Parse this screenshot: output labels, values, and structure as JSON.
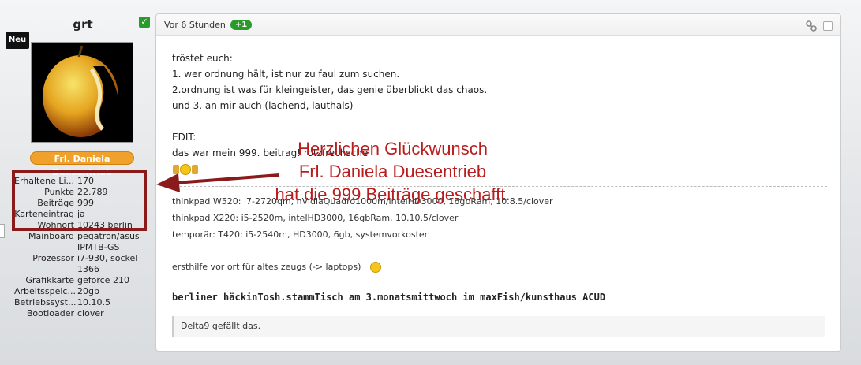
{
  "user": {
    "badge_new": "Neu",
    "name": "grt",
    "rank": "Frl. Daniela Duesentrieb",
    "info": [
      {
        "k": "Erhaltene Li...",
        "v": "170"
      },
      {
        "k": "Punkte",
        "v": "22.789"
      },
      {
        "k": "Beiträge",
        "v": "999"
      },
      {
        "k": "Karteneintrag",
        "v": "ja"
      },
      {
        "k": "Wohnort",
        "v": "10243 berlin"
      },
      {
        "k": "Mainboard",
        "v": "pegatron/asus IPMTB-GS"
      },
      {
        "k": "Prozessor",
        "v": "i7-930, sockel 1366"
      },
      {
        "k": "Grafikkarte",
        "v": "geforce 210"
      },
      {
        "k": "Arbeitsspeic...",
        "v": "20gb"
      },
      {
        "k": "Betriebssyst...",
        "v": "10.10.5"
      },
      {
        "k": "Bootloader",
        "v": "clover"
      }
    ]
  },
  "post": {
    "time": "Vor 6 Stunden",
    "plus": "+1",
    "lines": [
      "tröstet euch:",
      "1. wer ordnung hält, ist nur zu faul zum suchen.",
      "2.ordnung ist was für kleingeister, das genie überblickt das chaos.",
      "und 3. an mir auch (lachend, lauthals)"
    ],
    "edit_label": "EDIT:",
    "edit_text": "das war mein 999. beitrag! rotzfrechsche",
    "signature": [
      "thinkpad W520: i7-2720qm, nVidiaQuadro1000m/intelHD3000, 16gbRam, 10.8.5/clover",
      "thinkpad X220: i5-2520m, intelHD3000, 16gbRam, 10.10.5/clover",
      "temporär: T420: i5-2540m, HD3000, 6gb, systemvorkoster"
    ],
    "help_text": "ersthilfe vor ort für altes zeugs (-> laptops)",
    "stammtisch": "berliner häckinTosh.stammTisch am 3.monatsmittwoch im maxFish/kunsthaus ACUD",
    "likes": "Delta9 gefällt das."
  },
  "overlay": {
    "line1": "Herzlichen Glückwunsch",
    "line2": "Frl. Daniela Duesentrieb",
    "line3": "hat die 999 Beiträge geschafft."
  },
  "colors": {
    "accent_green": "#2a9a2a",
    "rank_orange": "#f0a12b",
    "annotation_red": "#b91c1c"
  }
}
